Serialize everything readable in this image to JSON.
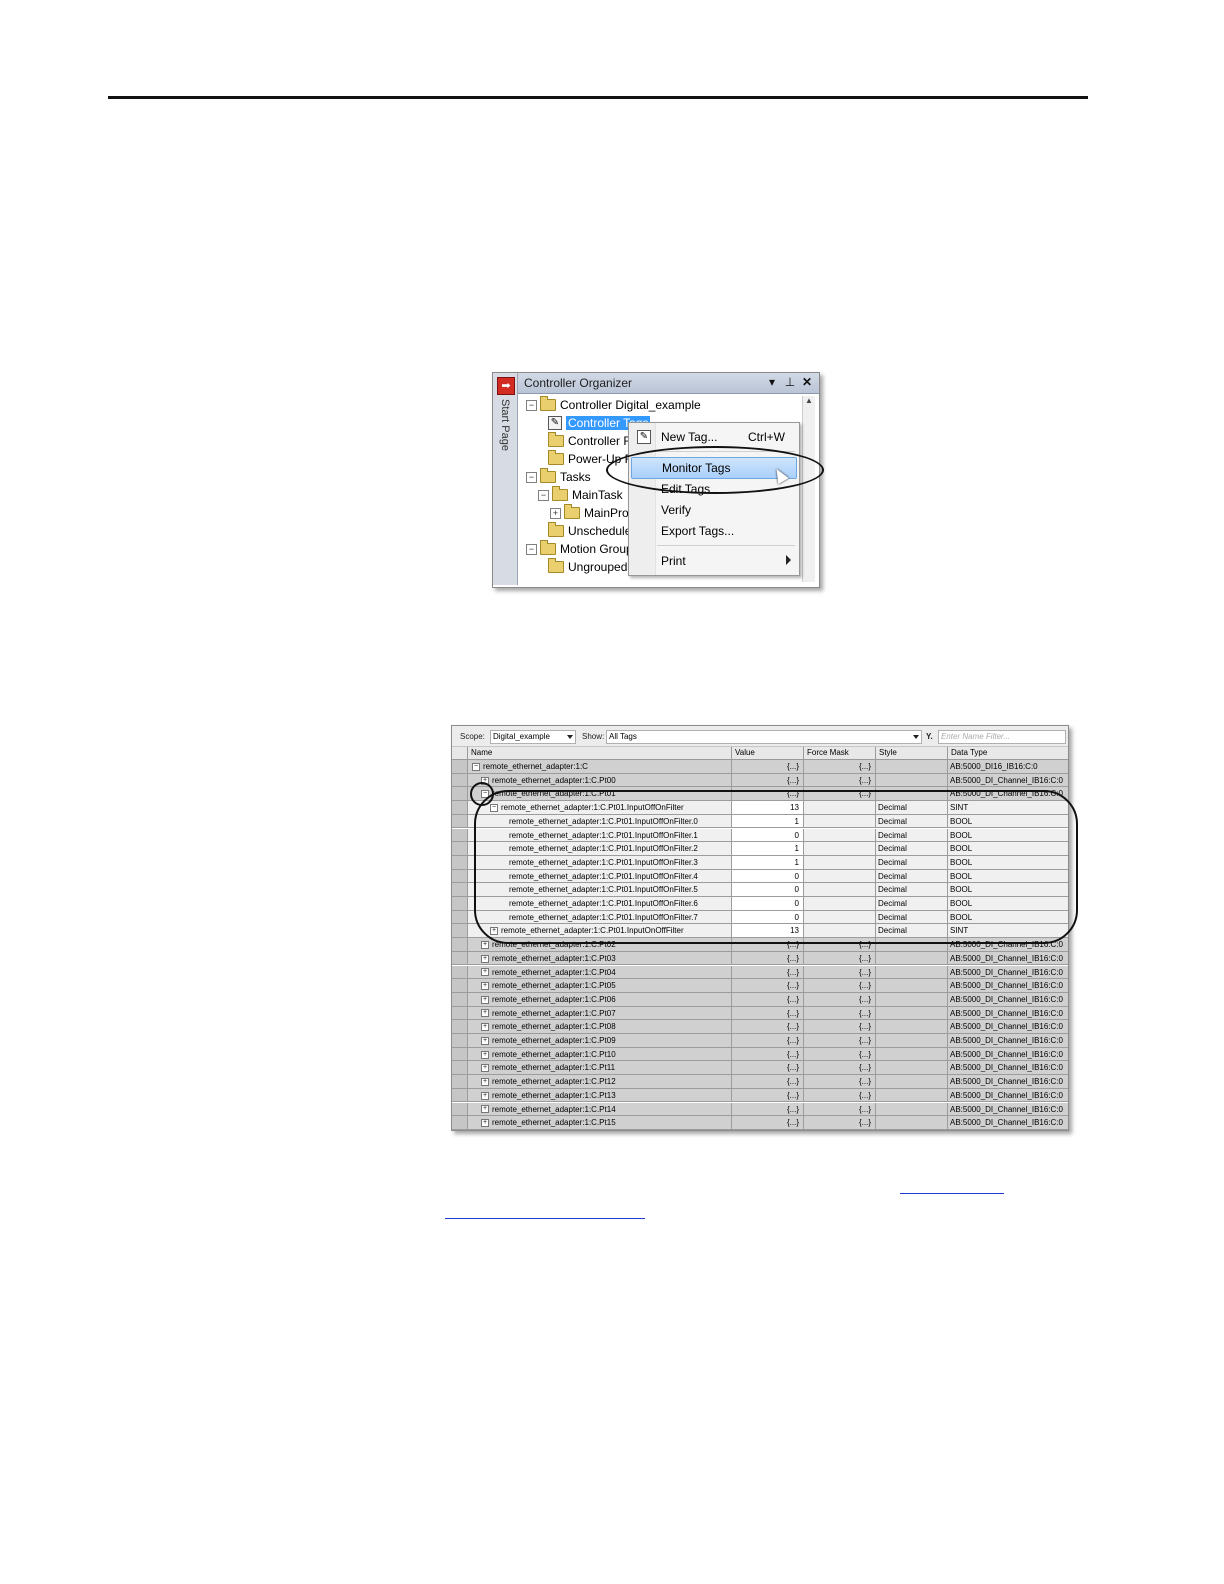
{
  "organizer": {
    "title": "Controller Organizer",
    "side_tab": "Start Page",
    "tree": [
      {
        "label": "Controller Digital_example"
      },
      {
        "label": "Controller Tags"
      },
      {
        "label": "Controller F"
      },
      {
        "label": "Power-Up F"
      },
      {
        "label": "Tasks"
      },
      {
        "label": "MainTask"
      },
      {
        "label": "MainPro"
      },
      {
        "label": "Unschedule"
      },
      {
        "label": "Motion Groups"
      },
      {
        "label": "Ungrouped"
      }
    ],
    "context_menu": [
      {
        "label": "New Tag...",
        "shortcut": "Ctrl+W"
      },
      {
        "label": "Monitor Tags"
      },
      {
        "label": "Edit Tags"
      },
      {
        "label": "Verify"
      },
      {
        "label": "Export Tags..."
      },
      {
        "label": "Print"
      }
    ]
  },
  "tags_window": {
    "scope_label": "Scope:",
    "scope_value": "Digital_example",
    "show_label": "Show:",
    "show_value": "All Tags",
    "filter_placeholder": "Enter Name Filter...",
    "columns": [
      "Name",
      "Value",
      "Force Mask",
      "Style",
      "Data Type"
    ],
    "rows": [
      {
        "name": "remote_ethernet_adapter:1:C",
        "value": "{...}",
        "force": "{...}",
        "style": "",
        "type": "AB:5000_DI16_IB16:C:0",
        "level": 0,
        "exp": "-"
      },
      {
        "name": "remote_ethernet_adapter:1:C.Pt00",
        "value": "{...}",
        "force": "{...}",
        "style": "",
        "type": "AB:5000_DI_Channel_IB16:C:0",
        "level": 1,
        "exp": "+"
      },
      {
        "name": "remote_ethernet_adapter:1:C.Pt01",
        "value": "{...}",
        "force": "{...}",
        "style": "",
        "type": "AB:5000_DI_Channel_IB16:C:0",
        "level": 1,
        "exp": "-"
      },
      {
        "name": "remote_ethernet_adapter:1:C.Pt01.InputOffOnFilter",
        "value": "13",
        "force": "",
        "style": "Decimal",
        "type": "SINT",
        "level": 2,
        "exp": "-",
        "detail": true
      },
      {
        "name": "remote_ethernet_adapter:1:C.Pt01.InputOffOnFilter.0",
        "value": "1",
        "force": "",
        "style": "Decimal",
        "type": "BOOL",
        "level": 3,
        "exp": "",
        "detail": true
      },
      {
        "name": "remote_ethernet_adapter:1:C.Pt01.InputOffOnFilter.1",
        "value": "0",
        "force": "",
        "style": "Decimal",
        "type": "BOOL",
        "level": 3,
        "exp": "",
        "detail": true
      },
      {
        "name": "remote_ethernet_adapter:1:C.Pt01.InputOffOnFilter.2",
        "value": "1",
        "force": "",
        "style": "Decimal",
        "type": "BOOL",
        "level": 3,
        "exp": "",
        "detail": true
      },
      {
        "name": "remote_ethernet_adapter:1:C.Pt01.InputOffOnFilter.3",
        "value": "1",
        "force": "",
        "style": "Decimal",
        "type": "BOOL",
        "level": 3,
        "exp": "",
        "detail": true
      },
      {
        "name": "remote_ethernet_adapter:1:C.Pt01.InputOffOnFilter.4",
        "value": "0",
        "force": "",
        "style": "Decimal",
        "type": "BOOL",
        "level": 3,
        "exp": "",
        "detail": true
      },
      {
        "name": "remote_ethernet_adapter:1:C.Pt01.InputOffOnFilter.5",
        "value": "0",
        "force": "",
        "style": "Decimal",
        "type": "BOOL",
        "level": 3,
        "exp": "",
        "detail": true
      },
      {
        "name": "remote_ethernet_adapter:1:C.Pt01.InputOffOnFilter.6",
        "value": "0",
        "force": "",
        "style": "Decimal",
        "type": "BOOL",
        "level": 3,
        "exp": "",
        "detail": true
      },
      {
        "name": "remote_ethernet_adapter:1:C.Pt01.InputOffOnFilter.7",
        "value": "0",
        "force": "",
        "style": "Decimal",
        "type": "BOOL",
        "level": 3,
        "exp": "",
        "detail": true
      },
      {
        "name": "remote_ethernet_adapter:1:C.Pt01.InputOnOffFilter",
        "value": "13",
        "force": "",
        "style": "Decimal",
        "type": "SINT",
        "level": 2,
        "exp": "+",
        "detail": true
      },
      {
        "name": "remote_ethernet_adapter:1:C.Pt02",
        "value": "{...}",
        "force": "{...}",
        "style": "",
        "type": "AB:5000_DI_Channel_IB16:C:0",
        "level": 1,
        "exp": "+"
      },
      {
        "name": "remote_ethernet_adapter:1:C.Pt03",
        "value": "{...}",
        "force": "{...}",
        "style": "",
        "type": "AB:5000_DI_Channel_IB16:C:0",
        "level": 1,
        "exp": "+"
      },
      {
        "name": "remote_ethernet_adapter:1:C.Pt04",
        "value": "{...}",
        "force": "{...}",
        "style": "",
        "type": "AB:5000_DI_Channel_IB16:C:0",
        "level": 1,
        "exp": "+"
      },
      {
        "name": "remote_ethernet_adapter:1:C.Pt05",
        "value": "{...}",
        "force": "{...}",
        "style": "",
        "type": "AB:5000_DI_Channel_IB16:C:0",
        "level": 1,
        "exp": "+"
      },
      {
        "name": "remote_ethernet_adapter:1:C.Pt06",
        "value": "{...}",
        "force": "{...}",
        "style": "",
        "type": "AB:5000_DI_Channel_IB16:C:0",
        "level": 1,
        "exp": "+"
      },
      {
        "name": "remote_ethernet_adapter:1:C.Pt07",
        "value": "{...}",
        "force": "{...}",
        "style": "",
        "type": "AB:5000_DI_Channel_IB16:C:0",
        "level": 1,
        "exp": "+"
      },
      {
        "name": "remote_ethernet_adapter:1:C.Pt08",
        "value": "{...}",
        "force": "{...}",
        "style": "",
        "type": "AB:5000_DI_Channel_IB16:C:0",
        "level": 1,
        "exp": "+"
      },
      {
        "name": "remote_ethernet_adapter:1:C.Pt09",
        "value": "{...}",
        "force": "{...}",
        "style": "",
        "type": "AB:5000_DI_Channel_IB16:C:0",
        "level": 1,
        "exp": "+"
      },
      {
        "name": "remote_ethernet_adapter:1:C.Pt10",
        "value": "{...}",
        "force": "{...}",
        "style": "",
        "type": "AB:5000_DI_Channel_IB16:C:0",
        "level": 1,
        "exp": "+"
      },
      {
        "name": "remote_ethernet_adapter:1:C.Pt11",
        "value": "{...}",
        "force": "{...}",
        "style": "",
        "type": "AB:5000_DI_Channel_IB16:C:0",
        "level": 1,
        "exp": "+"
      },
      {
        "name": "remote_ethernet_adapter:1:C.Pt12",
        "value": "{...}",
        "force": "{...}",
        "style": "",
        "type": "AB:5000_DI_Channel_IB16:C:0",
        "level": 1,
        "exp": "+"
      },
      {
        "name": "remote_ethernet_adapter:1:C.Pt13",
        "value": "{...}",
        "force": "{...}",
        "style": "",
        "type": "AB:5000_DI_Channel_IB16:C:0",
        "level": 1,
        "exp": "+"
      },
      {
        "name": "remote_ethernet_adapter:1:C.Pt14",
        "value": "{...}",
        "force": "{...}",
        "style": "",
        "type": "AB:5000_DI_Channel_IB16:C:0",
        "level": 1,
        "exp": "+"
      },
      {
        "name": "remote_ethernet_adapter:1:C.Pt15",
        "value": "{...}",
        "force": "{...}",
        "style": "",
        "type": "AB:5000_DI_Channel_IB16:C:0",
        "level": 1,
        "exp": "+"
      }
    ]
  },
  "colors": {
    "selection": "#3399ff",
    "menu_highlight": "#a9cffa",
    "link": "#1f3bd6"
  }
}
